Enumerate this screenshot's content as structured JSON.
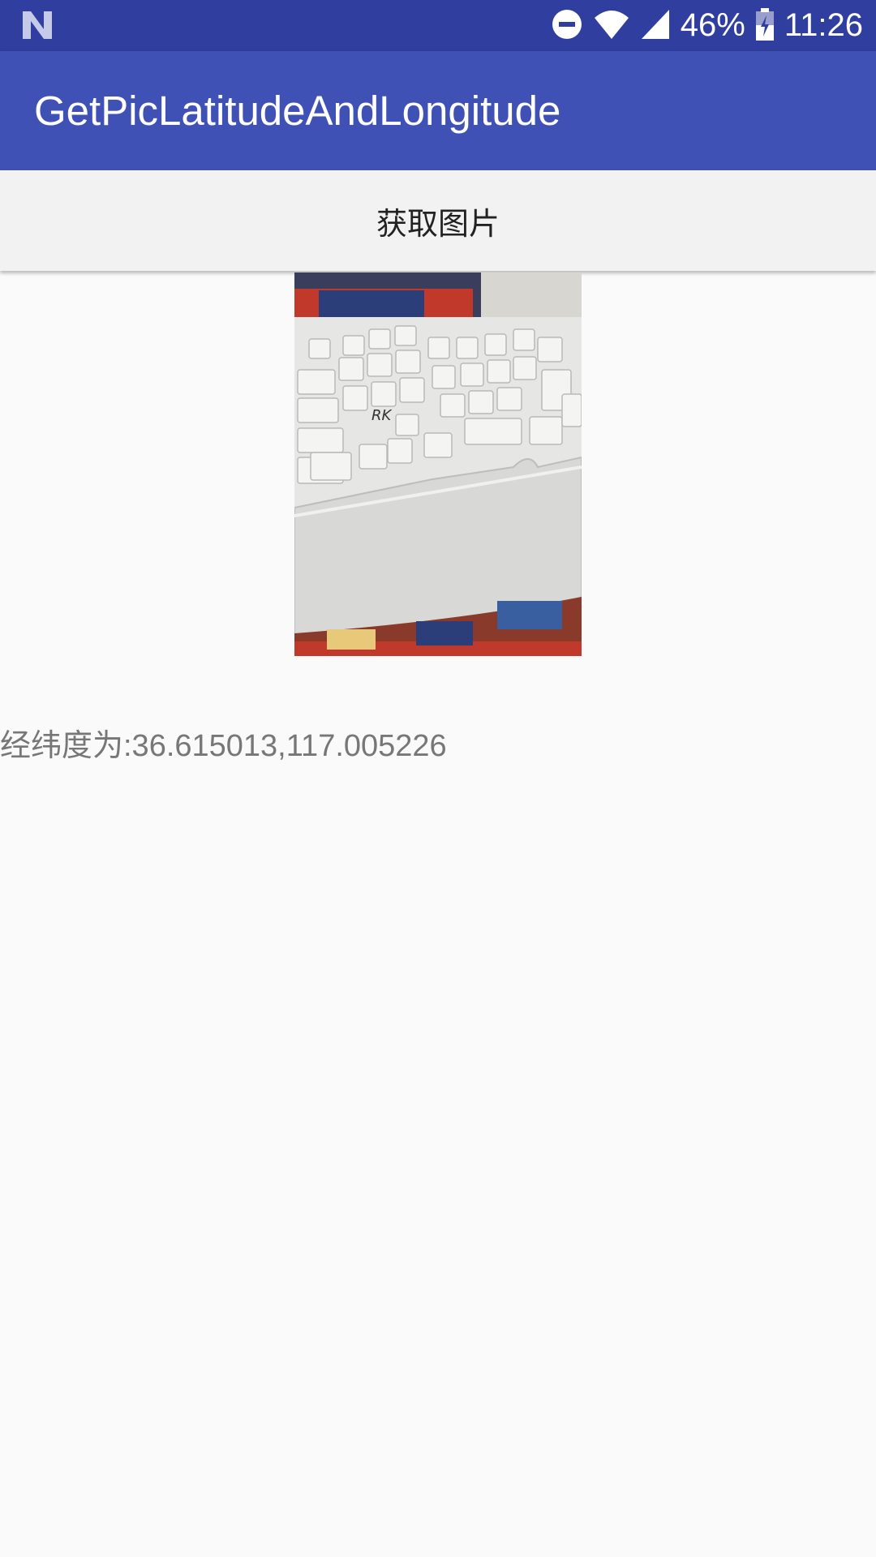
{
  "status_bar": {
    "battery": "46%",
    "time": "11:26",
    "icons": [
      "notification-n-icon",
      "do-not-disturb-icon",
      "wifi-icon",
      "cell-signal-icon",
      "battery-icon"
    ]
  },
  "app_bar": {
    "title": "GetPicLatitudeAndLongitude"
  },
  "main": {
    "pick_button_label": "获取图片",
    "result_text": "经纬度为:36.615013,117.005226"
  },
  "colors": {
    "status_bar": "#303f9f",
    "app_bar": "#3f51b5",
    "background": "#fafafa"
  }
}
